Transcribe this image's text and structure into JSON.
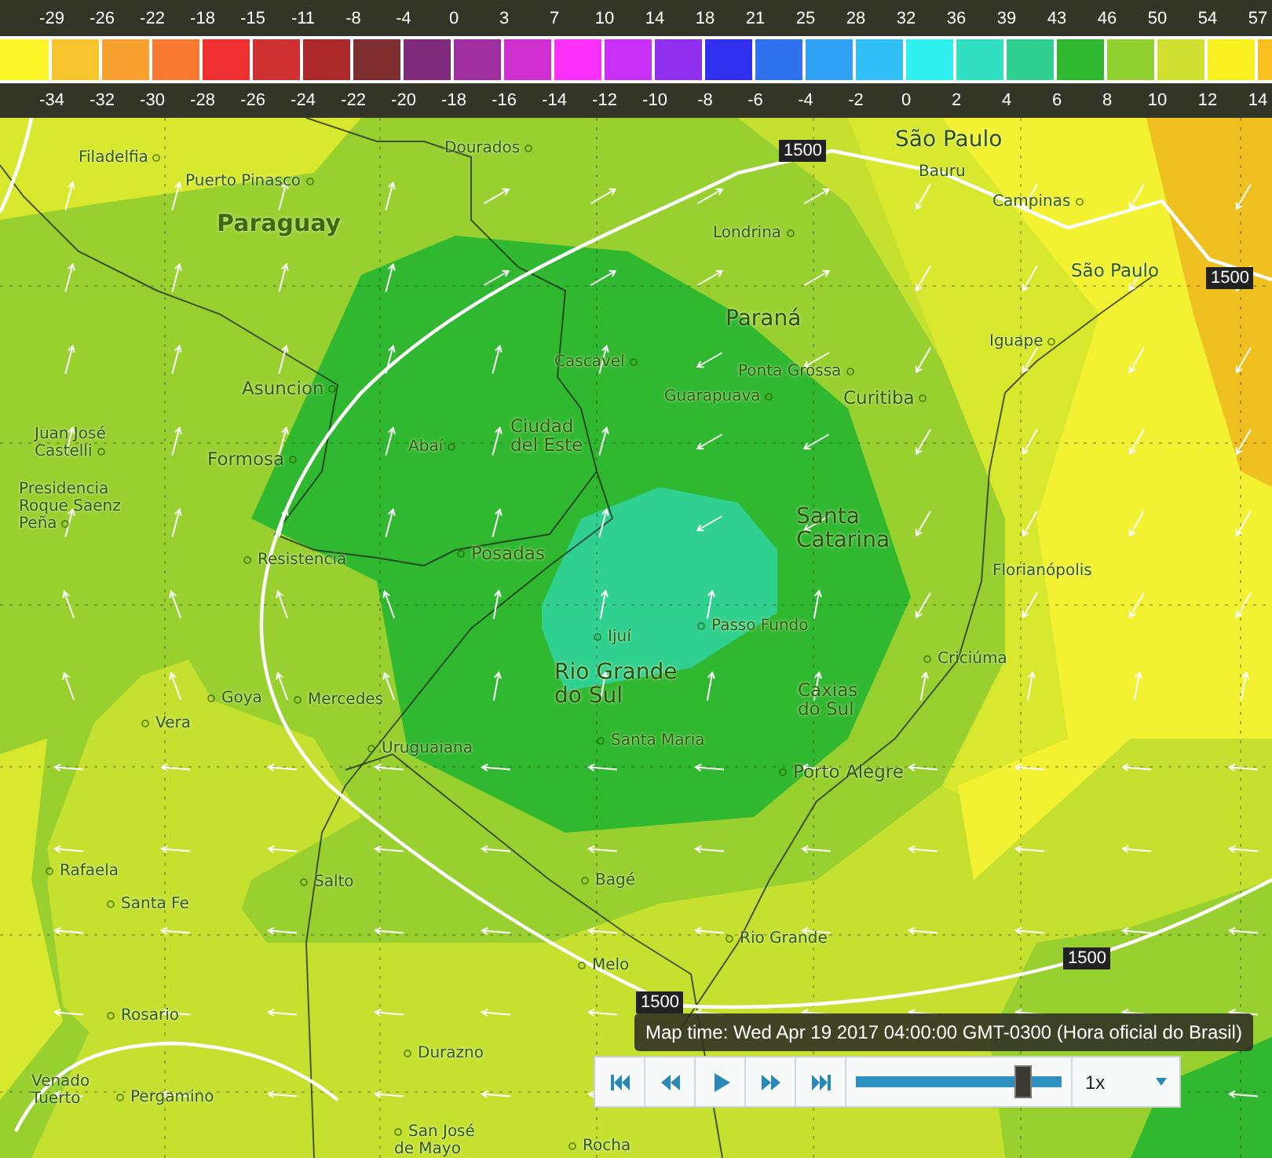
{
  "legend": {
    "fahrenheit_labels": [
      "-29",
      "-26",
      "-22",
      "-18",
      "-15",
      "-11",
      "-8",
      "-4",
      "0",
      "3",
      "7",
      "10",
      "14",
      "18",
      "21",
      "25",
      "28",
      "32",
      "36",
      "39",
      "43",
      "46",
      "50",
      "54",
      "57"
    ],
    "swatches": [
      {
        "color": "#fcf52a"
      },
      {
        "color": "#f7c62e"
      },
      {
        "color": "#f7a030"
      },
      {
        "color": "#f77a30"
      },
      {
        "color": "#ef3030"
      },
      {
        "color": "#cf3030"
      },
      {
        "color": "#ad2a2a"
      },
      {
        "color": "#7f2e30"
      },
      {
        "color": "#7f2a7a"
      },
      {
        "color": "#a030a0"
      },
      {
        "color": "#d030d0"
      },
      {
        "color": "#fb30fb"
      },
      {
        "color": "#c830f5"
      },
      {
        "color": "#9030ee"
      },
      {
        "color": "#3030ee"
      },
      {
        "color": "#3072ee"
      },
      {
        "color": "#30a0f5"
      },
      {
        "color": "#30c0f5"
      },
      {
        "color": "#30f0f0"
      },
      {
        "color": "#30e0c0"
      },
      {
        "color": "#30d090"
      },
      {
        "color": "#30b830"
      },
      {
        "color": "#90d030"
      },
      {
        "color": "#d0e030"
      },
      {
        "color": "#f8f020"
      },
      {
        "color": "#f8c020"
      }
    ],
    "celsius_labels": [
      "-34",
      "-32",
      "-30",
      "-28",
      "-26",
      "-24",
      "-22",
      "-20",
      "-18",
      "-16",
      "-14",
      "-12",
      "-10",
      "-8",
      "-6",
      "-4",
      "-2",
      "0",
      "2",
      "4",
      "6",
      "8",
      "10",
      "12",
      "14"
    ]
  },
  "map": {
    "labels": [
      {
        "text": "Filadelfia",
        "kind": "city"
      },
      {
        "text": "Puerto Pinasco",
        "kind": "city"
      },
      {
        "text": "Dourados",
        "kind": "city"
      },
      {
        "text": "Paraguay",
        "kind": "country"
      },
      {
        "text": "São Paulo",
        "kind": "region"
      },
      {
        "text": "Bauru",
        "kind": "city"
      },
      {
        "text": "Campinas",
        "kind": "city"
      },
      {
        "text": "Londrina",
        "kind": "city"
      },
      {
        "text": "São Paulo",
        "kind": "capital"
      },
      {
        "text": "Paraná",
        "kind": "region"
      },
      {
        "text": "Iguape",
        "kind": "city"
      },
      {
        "text": "Cascavel",
        "kind": "city"
      },
      {
        "text": "Asuncion",
        "kind": "capital"
      },
      {
        "text": "Ponta Grossa",
        "kind": "city"
      },
      {
        "text": "Guarapuava",
        "kind": "city"
      },
      {
        "text": "Curitiba",
        "kind": "capital"
      },
      {
        "text": "Juan José\nCastelli",
        "kind": "city"
      },
      {
        "text": "Formosa",
        "kind": "capital"
      },
      {
        "text": "Abaí",
        "kind": "city"
      },
      {
        "text": "Ciudad\ndel Este",
        "kind": "capital"
      },
      {
        "text": "Presidencia\nRoque Saenz\nPeña",
        "kind": "city"
      },
      {
        "text": "Resistencia",
        "kind": "city"
      },
      {
        "text": "Posadas",
        "kind": "capital"
      },
      {
        "text": "Santa\nCatarina",
        "kind": "region"
      },
      {
        "text": "Florianópolis",
        "kind": "city"
      },
      {
        "text": "Ijuí",
        "kind": "city"
      },
      {
        "text": "Passo Fundo",
        "kind": "city"
      },
      {
        "text": "Goya",
        "kind": "city"
      },
      {
        "text": "Mercedes",
        "kind": "city"
      },
      {
        "text": "Rio Grande\ndo Sul",
        "kind": "region"
      },
      {
        "text": "Vera",
        "kind": "city"
      },
      {
        "text": "Caxias\ndo Sul",
        "kind": "capital"
      },
      {
        "text": "Criciúma",
        "kind": "city"
      },
      {
        "text": "Uruguaiana",
        "kind": "city"
      },
      {
        "text": "Santa Maria",
        "kind": "city"
      },
      {
        "text": "Porto Alegre",
        "kind": "capital"
      },
      {
        "text": "Rafaela",
        "kind": "city"
      },
      {
        "text": "Salto",
        "kind": "city"
      },
      {
        "text": "Bagé",
        "kind": "city"
      },
      {
        "text": "Santa Fe",
        "kind": "city"
      },
      {
        "text": "Rio Grande",
        "kind": "city"
      },
      {
        "text": "Melo",
        "kind": "city"
      },
      {
        "text": "Rosario",
        "kind": "city"
      },
      {
        "text": "Durazno",
        "kind": "city"
      },
      {
        "text": "Venado\nTuerto",
        "kind": "city"
      },
      {
        "text": "Pergamino",
        "kind": "city"
      },
      {
        "text": "San José\nde Mayo",
        "kind": "city"
      },
      {
        "text": "Rocha",
        "kind": "city"
      }
    ],
    "contour_labels": [
      "1500",
      "1500",
      "1500",
      "1500"
    ]
  },
  "player": {
    "map_time": "Map time: Wed Apr 19 2017 04:00:00 GMT-0300 (Hora oficial do Brasil)",
    "buttons": [
      {
        "kind": "skip-start"
      },
      {
        "kind": "step-back"
      },
      {
        "kind": "play"
      },
      {
        "kind": "step-forward"
      },
      {
        "kind": "skip-end"
      }
    ],
    "slider": {
      "level": 0.81
    },
    "speed": "1x"
  }
}
